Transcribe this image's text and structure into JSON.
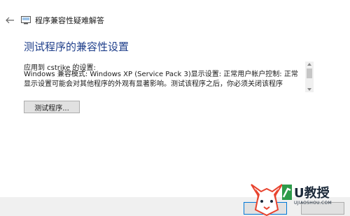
{
  "window": {
    "title": "程序兼容性疑难解答",
    "back_icon": "back-arrow-icon",
    "app_icon": "compatibility-troubleshooter-icon"
  },
  "main": {
    "heading": "测试程序的兼容性设置",
    "applies_to": "应用到 cstrike 的设置:",
    "settings_lines": [
      "Windows 兼容模式: Windows XP (Service Pack 3)显示设置: 正常用户帐户控制: 正常",
      "显示设置可能会对其他程序的外观有显著影响。测试该程序之后，你必须关闭该程序"
    ],
    "test_button_label": "测试程序..."
  },
  "footer": {
    "next_button_label": "",
    "cancel_button_label": ""
  },
  "watermark": {
    "brand": "U教授",
    "url": "UJIAOSHOU.COM",
    "colors": {
      "red": "#e8432e",
      "green": "#2e9b4a",
      "dark": "#1c2a3a"
    }
  }
}
